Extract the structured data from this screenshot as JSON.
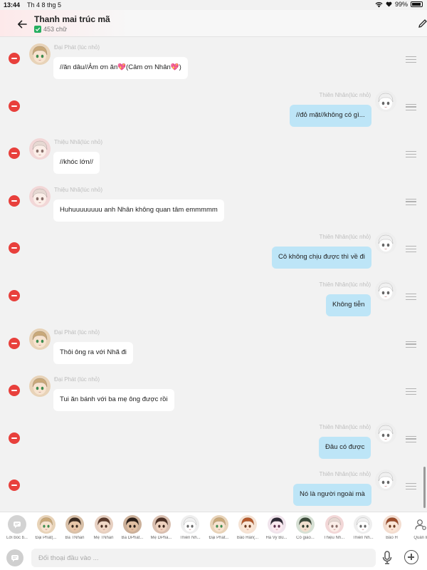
{
  "status_bar": {
    "time": "13:44",
    "date": "Th 4 8 thg 5",
    "battery": "99%"
  },
  "header": {
    "title": "Thanh mai trúc mã",
    "word_count": "453 chữ"
  },
  "messages": [
    {
      "side": "left",
      "avatar": "phat",
      "name": "Đại Phát (lúc nhỏ)",
      "text": "//ăn dâu//Ảm ơn ăn💖(Cảm ơn Nhân💖)"
    },
    {
      "side": "right",
      "avatar": "nhan",
      "name": "Thiên Nhân(lúc nhỏ)",
      "text": "//đỏ mặt//không có gì..."
    },
    {
      "side": "left",
      "avatar": "nha",
      "name": "Thiệu Nhã(lúc nhỏ)",
      "text": "//khóc lớn//"
    },
    {
      "side": "left",
      "avatar": "nha",
      "name": "Thiệu Nhã(lúc nhỏ)",
      "text": "Huhuuuuuuuu anh Nhân không quan tâm emmmmm"
    },
    {
      "side": "right",
      "avatar": "nhan",
      "name": "Thiên Nhân(lúc nhỏ)",
      "text": "Cô không chịu được thì về đi"
    },
    {
      "side": "right",
      "avatar": "nhan",
      "name": "Thiên Nhân(lúc nhỏ)",
      "text": "Không tiễn"
    },
    {
      "side": "left",
      "avatar": "phat",
      "name": "Đại Phát (lúc nhỏ)",
      "text": "Thôi ông ra với Nhã đi"
    },
    {
      "side": "left",
      "avatar": "phat",
      "name": "Đại Phát (lúc nhỏ)",
      "text": "Tui ăn bánh với ba mẹ ông được rồi"
    },
    {
      "side": "right",
      "avatar": "nhan",
      "name": "Thiên Nhân(lúc nhỏ)",
      "text": "Đâu có được"
    },
    {
      "side": "right",
      "avatar": "nhan",
      "name": "Thiên Nhân(lúc nhỏ)",
      "text": "Nó là người ngoài mà"
    }
  ],
  "characters": [
    {
      "label": "Lời bốc b...",
      "avatar": "narrator"
    },
    {
      "label": "Đại Phát(...",
      "avatar": "phat"
    },
    {
      "label": "Ba TNhan",
      "avatar": "dad"
    },
    {
      "label": "Mẹ TNhan",
      "avatar": "mom"
    },
    {
      "label": "Ba DPhat...",
      "avatar": "dad2"
    },
    {
      "label": "Mẹ DPha...",
      "avatar": "mom2"
    },
    {
      "label": "Thiên Nh...",
      "avatar": "nhan"
    },
    {
      "label": "Đại Phát...",
      "avatar": "phat"
    },
    {
      "label": "Bảo Hân(...",
      "avatar": "han"
    },
    {
      "label": "Hà Vy Bù...",
      "avatar": "vy"
    },
    {
      "label": "Cô giáo...",
      "avatar": "teacher"
    },
    {
      "label": "Thiệu Nh...",
      "avatar": "nha"
    },
    {
      "label": "Thiên Nh...",
      "avatar": "nhan"
    },
    {
      "label": "Bảo H",
      "avatar": "han2"
    },
    {
      "label": "Quản lí",
      "avatar": "manage"
    }
  ],
  "input": {
    "placeholder": "Đối thoại đầu vào ..."
  },
  "avatar_colors": {
    "phat": {
      "bg": "#e8d3b8",
      "hair": "#c9a97a",
      "skin": "#f7e3d0",
      "eye": "#3e8c4f"
    },
    "nhan": {
      "bg": "#eeeeee",
      "hair": "#f0f0f0",
      "skin": "#ffffff",
      "eye": "#666666"
    },
    "nha": {
      "bg": "#f2d7d7",
      "hair": "#e6d8d2",
      "skin": "#fbeee8",
      "eye": "#8a6f6a"
    },
    "dad": {
      "bg": "#d8c0a8",
      "hair": "#3a2a20",
      "skin": "#e8c6a8",
      "eye": "#3a2a20"
    },
    "mom": {
      "bg": "#e6cfc0",
      "hair": "#5a3a2c",
      "skin": "#f1d8c6",
      "eye": "#4a2e22"
    },
    "dad2": {
      "bg": "#cbb09a",
      "hair": "#2a1e18",
      "skin": "#e0bfa2",
      "eye": "#2a1e18"
    },
    "mom2": {
      "bg": "#d9bfb0",
      "hair": "#4b2f24",
      "skin": "#efd2bf",
      "eye": "#3b241b"
    },
    "han": {
      "bg": "#f5e3d4",
      "hair": "#b55a2d",
      "skin": "#fbe6d6",
      "eye": "#6a3a20"
    },
    "vy": {
      "bg": "#f0e4ec",
      "hair": "#2f2a36",
      "skin": "#fbeaf0",
      "eye": "#5a2d4a"
    },
    "teacher": {
      "bg": "#d6e0d4",
      "hair": "#3c4a3a",
      "skin": "#f2e0cf",
      "eye": "#2e3a2c"
    },
    "han2": {
      "bg": "#f3ddd0",
      "hair": "#9c4c2a",
      "skin": "#fbe6d6",
      "eye": "#6a3a20"
    }
  }
}
